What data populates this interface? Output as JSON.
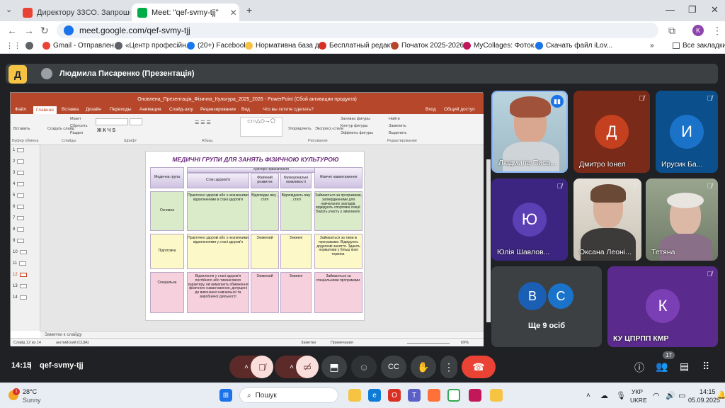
{
  "browser": {
    "tabs": [
      {
        "title": "Директору 33СО. Запрошення",
        "active": false
      },
      {
        "title": "Meet: \"qef-svmy-tjj\"",
        "active": true
      }
    ],
    "new_tab": "+",
    "url": "meet.google.com/qef-svmy-tjj",
    "profile_initial": "K",
    "bookmarks": [
      "Gmail - Отправлен...",
      "«Центр професійн...",
      "(20+) Facebook",
      "Нормативна база д...",
      "Бесплатный редакт...",
      "Початок 2025-2026...",
      "MyCollages: Фоток...",
      "Скачать файл iLov..."
    ],
    "all_bookmarks": "Все закладки"
  },
  "meet": {
    "logo_letter": "Д",
    "presenter_label": "Людмила Писаренко (Презентація)",
    "time": "14:15",
    "code": "qef-svmy-tjj",
    "participants_count": "17",
    "participants": [
      {
        "name": "Людмила Писа...",
        "type": "video",
        "speaking": true
      },
      {
        "name": "Дмитро Іонел",
        "initial": "Д",
        "color": "#c5401f",
        "bg": "#7a2a18"
      },
      {
        "name": "Ирусик Ба...",
        "initial": "И",
        "color": "#1a73c8",
        "bg": "#0b4f8c"
      },
      {
        "name": "Юлія Шавлов...",
        "initial": "Ю",
        "color": "#5b3fb5",
        "bg": "#3b2580"
      },
      {
        "name": "Оксана Леоні...",
        "type": "video"
      },
      {
        "name": "Тетяна",
        "type": "video"
      },
      {
        "name": "Ще 9 осіб",
        "initials": [
          "В",
          "С"
        ]
      },
      {
        "name": "КУ ЦПРПП КМР",
        "initial": "К",
        "color": "#7b3fb5",
        "bg": "#5a2a8c"
      }
    ]
  },
  "ppt": {
    "title": "Оновлена_Презентація_Фізична_Культура_2025_2026 - PowerPoint (Сбой активации продукта)",
    "menu": [
      "Файл",
      "Главная",
      "Вставка",
      "Дизайн",
      "Переходы",
      "Анимация",
      "Слайд-шоу",
      "Рецензирование",
      "Вид",
      "Что вы хотите сделать?",
      "Вход",
      "Общий доступ"
    ],
    "ribbon_groups": [
      "Буфер обмена",
      "Слайды",
      "Шрифт",
      "Абзац",
      "Рисование",
      "Редактирование"
    ],
    "ribbon_items": [
      "Вставить",
      "Создать слайд",
      "Макет",
      "Сбросить",
      "Раздел",
      "Упорядочить",
      "Экспресс-стили",
      "Заливка фигуры",
      "Контур фигуры",
      "Эффекты фигуры",
      "Найти",
      "Заменить",
      "Выделить"
    ],
    "slide_numbers": [
      "1",
      "2",
      "3",
      "4",
      "5",
      "6",
      "7",
      "8",
      "9",
      "10",
      "11",
      "12",
      "13",
      "14"
    ],
    "notes_placeholder": "Заметки к слайду",
    "status": {
      "slide": "Слайд 12 из 14",
      "lang": "английский (США)",
      "notes": "Заметки",
      "comments": "Примечания",
      "zoom": "69%"
    },
    "slide": {
      "title": "МЕДИЧНІ ГРУПИ ДЛЯ ЗАНЯТЬ ФІЗИЧНОЮ КУЛЬТУРОЮ",
      "criteria": "Критерії призначення",
      "headers": [
        "Медична група",
        "Стан здоров'я",
        "Фізичний розвиток",
        "Функціональні можливості",
        "Фізичні навантаження"
      ],
      "rows": [
        {
          "group": "Основна",
          "health": "Практично здорові або з незначними відхиленнями в стані здоров'я",
          "dev": "Відповідає віку , статі",
          "func": "Відповідають віку , статі",
          "load": "Займаються за програмами, затвердженими для навчальних закладів, відвідують спортивні секції. Беруть участь у змаганнях."
        },
        {
          "group": "Підготовча",
          "health": "Практично здорові або з незначними відхиленнями у стані здоров'я",
          "dev": "Знижений",
          "func": "Знижені",
          "load": "Займаються за тими ж програмами. Відвідують додаткові заняття. Здають нормативи у більш пізні терміни."
        },
        {
          "group": "Спеціальна",
          "health": "Відхилення у стані здоров'я постійного або тимчасового характеру, які вимагають обмеження фізичного навантаження, допущені до виконання навчальної та виробничої діяльності",
          "dev": "Знижений",
          "func": "Знижені",
          "load": "Займаються за спеціальними програмами."
        }
      ]
    }
  },
  "taskbar": {
    "weather_temp": "28°C",
    "weather_desc": "Sunny",
    "search": "Пошук",
    "lang": "УКР",
    "lang2": "UKRE",
    "time": "14:15",
    "date": "05.09.2025"
  }
}
